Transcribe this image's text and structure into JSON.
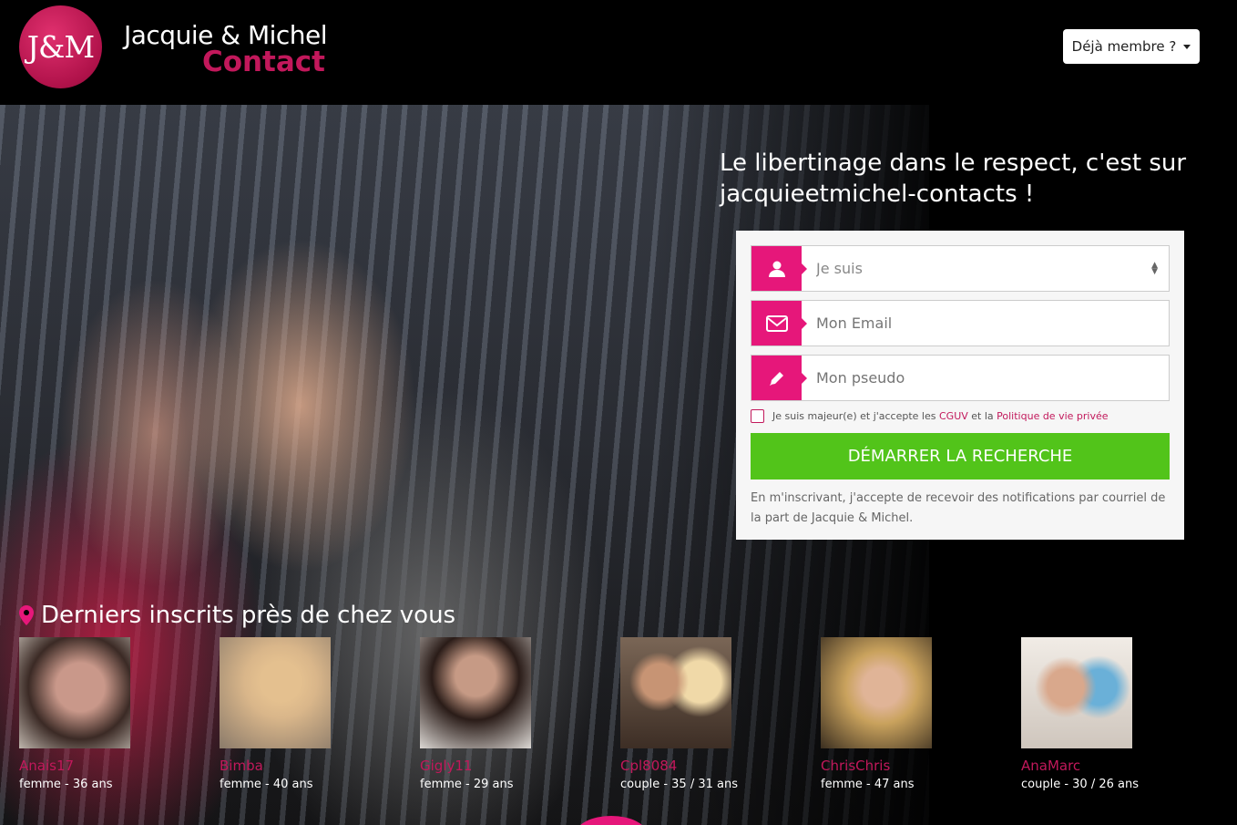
{
  "header": {
    "logo_text": "J&M",
    "brand_line1": "Jacquie & Michel",
    "brand_line2": "Contact",
    "member_button": "Déjà membre ?"
  },
  "hero": {
    "tagline": "Le libertinage dans le respect, c'est sur jacquieetmichel-contacts !"
  },
  "form": {
    "select_value": "Je suis",
    "email_placeholder": "Mon Email",
    "pseudo_placeholder": "Mon pseudo",
    "consent_prefix": "Je suis majeur(e) et j'accepte les",
    "consent_cguv": "CGUV",
    "consent_mid": "et la",
    "consent_privacy": "Politique de vie privée",
    "submit": "DÉMARRER LA RECHERCHE",
    "notice": "En m'inscrivant, j'accepte de recevoir des notifications par courriel de la part de Jacquie & Michel."
  },
  "members": {
    "title": "Derniers inscrits près de chez vous",
    "items": [
      {
        "name": "Anais17",
        "info": "femme - 36 ans"
      },
      {
        "name": "Bimba",
        "info": "femme - 40 ans"
      },
      {
        "name": "Gigly11",
        "info": "femme - 29 ans"
      },
      {
        "name": "Cpl8084",
        "info": "couple - 35 / 31 ans"
      },
      {
        "name": "ChrisChris",
        "info": "femme - 47 ans"
      },
      {
        "name": "AnaMarc",
        "info": "couple - 30 / 26 ans"
      }
    ]
  },
  "colors": {
    "accent": "#e6177a",
    "brand": "#c2185b",
    "cta": "#52c41a"
  }
}
